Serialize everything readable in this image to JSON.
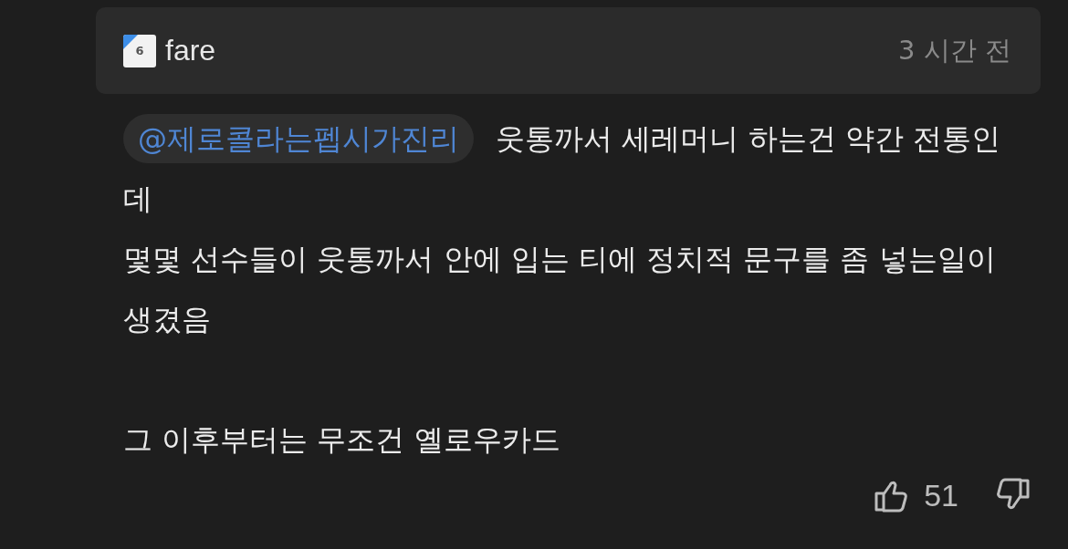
{
  "comment": {
    "author": {
      "level_badge": "6",
      "name": "fare"
    },
    "time": "3 시간 전",
    "mention": "@제로콜라는펩시가진리",
    "body": " 웃통까서 세레머니 하는건 약간 전통인데\n몇몇 선수들이 웃통까서 안에 입는 티에 정치적 문구를 좀 넣는일이 생겼음\n\n그 이후부터는 무조건 옐로우카드",
    "likes": "51"
  }
}
